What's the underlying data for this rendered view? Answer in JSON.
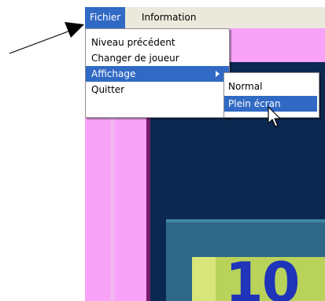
{
  "menubar": {
    "items": [
      {
        "label": "Fichier",
        "active": true
      },
      {
        "label": "Information",
        "active": false
      }
    ]
  },
  "fichier_menu": {
    "items": [
      {
        "label": "Niveau précédent"
      },
      {
        "label": "Changer de joueur"
      },
      {
        "label": "Affichage",
        "has_submenu": true,
        "active": true
      },
      {
        "label": "Quitter"
      }
    ]
  },
  "affichage_submenu": {
    "items": [
      {
        "label": "Normal"
      },
      {
        "label": "Plein écran",
        "active": true
      }
    ]
  },
  "game": {
    "score_display": "10"
  },
  "colors": {
    "menu_highlight": "#316ac5",
    "window_background": "#f8a2f8",
    "board_background": "#0b2850",
    "score_color": "#1f34b8"
  }
}
